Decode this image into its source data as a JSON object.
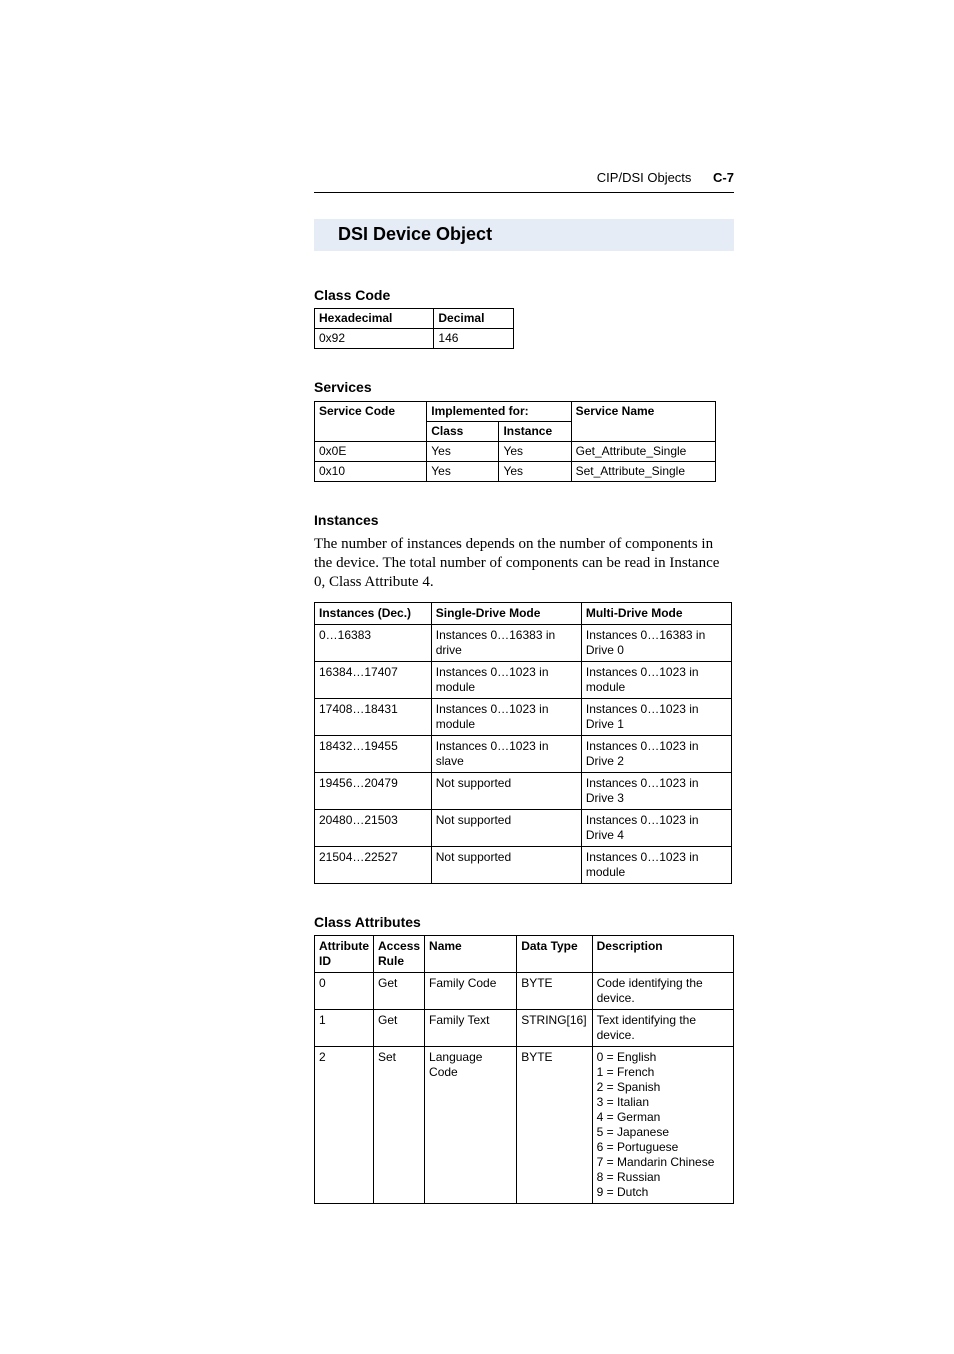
{
  "header": {
    "section": "CIP/DSI Objects",
    "page_number": "C-7"
  },
  "title": "DSI Device Object",
  "class_code": {
    "heading": "Class Code",
    "headers": {
      "hex": "Hexadecimal",
      "dec": "Decimal"
    },
    "row": {
      "hex": "0x92",
      "dec": "146"
    }
  },
  "services": {
    "heading": "Services",
    "headers": {
      "code": "Service Code",
      "impl": "Implemented for:",
      "class": "Class",
      "instance": "Instance",
      "name": "Service Name"
    },
    "rows": [
      {
        "code": "0x0E",
        "class": "Yes",
        "instance": "Yes",
        "name": "Get_Attribute_Single"
      },
      {
        "code": "0x10",
        "class": "Yes",
        "instance": "Yes",
        "name": "Set_Attribute_Single"
      }
    ]
  },
  "instances": {
    "heading": "Instances",
    "description": "The number of instances depends on the number of components in the device. The total number of components can be read in Instance 0, Class Attribute 4.",
    "headers": {
      "dec": "Instances (Dec.)",
      "single": "Single-Drive Mode",
      "multi": "Multi-Drive Mode"
    },
    "rows": [
      {
        "dec": "0…16383",
        "single": "Instances 0…16383 in drive",
        "multi": "Instances 0…16383 in Drive 0"
      },
      {
        "dec": "16384…17407",
        "single": "Instances 0…1023 in module",
        "multi": "Instances 0…1023 in module"
      },
      {
        "dec": "17408…18431",
        "single": "Instances 0…1023 in module",
        "multi": "Instances 0…1023 in Drive 1"
      },
      {
        "dec": "18432…19455",
        "single": "Instances 0…1023 in slave",
        "multi": "Instances 0…1023 in Drive 2"
      },
      {
        "dec": "19456…20479",
        "single": "Not supported",
        "multi": "Instances 0…1023 in Drive 3"
      },
      {
        "dec": "20480…21503",
        "single": "Not supported",
        "multi": "Instances 0…1023 in Drive 4"
      },
      {
        "dec": "21504…22527",
        "single": "Not supported",
        "multi": "Instances 0…1023 in module"
      }
    ]
  },
  "class_attrs": {
    "heading": "Class Attributes",
    "headers": {
      "id": "Attribute ID",
      "access": "Access Rule",
      "name": "Name",
      "dtype": "Data Type",
      "desc": "Description"
    },
    "rows": [
      {
        "id": "0",
        "access": "Get",
        "name": "Family Code",
        "dtype": "BYTE",
        "desc": "Code identifying the device."
      },
      {
        "id": "1",
        "access": "Get",
        "name": "Family Text",
        "dtype": "STRING[16]",
        "desc": "Text identifying the device."
      },
      {
        "id": "2",
        "access": "Set",
        "name": "Language Code",
        "dtype": "BYTE",
        "desc": "0 = English\n1 = French\n2 = Spanish\n3 = Italian\n4 = German\n5 = Japanese\n6 = Portuguese\n7 = Mandarin Chinese\n8 = Russian\n9 = Dutch"
      }
    ]
  }
}
